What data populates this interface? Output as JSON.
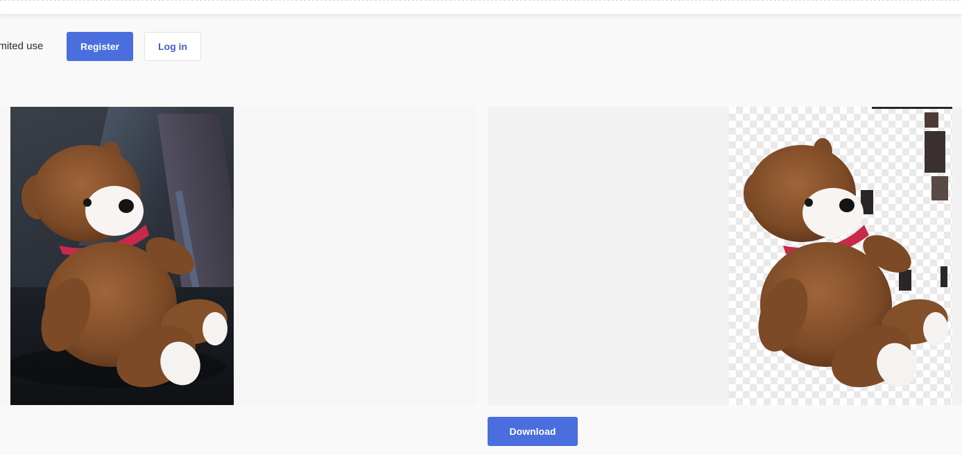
{
  "auth": {
    "limited_text": "imited use",
    "register_label": "Register",
    "login_label": "Log in"
  },
  "images": {
    "original_name": "teddy-bear-original",
    "result_name": "teddy-bear-background-removed"
  },
  "actions": {
    "download_label": "Download"
  },
  "colors": {
    "accent": "#4a6ede",
    "link": "#3f5fc6"
  }
}
